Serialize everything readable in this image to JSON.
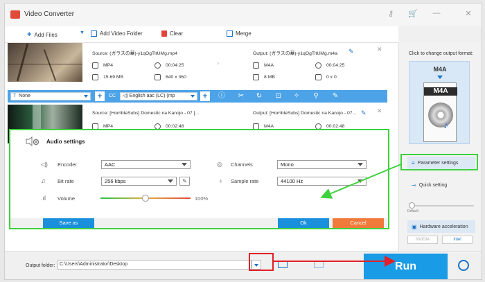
{
  "window": {
    "title": "Video Converter"
  },
  "toolbar": {
    "add_files": "Add Files",
    "add_video_folder": "Add Video Folder",
    "clear": "Clear",
    "merge": "Merge"
  },
  "files": [
    {
      "source_name": "Source: (ガラスの華)-y1qOgTltUMg.mp4",
      "source_format": "MP4",
      "source_duration": "00:04:25",
      "source_size": "15.69 MB",
      "source_resolution": "640 x 360",
      "output_name": "Output: (ガラスの華)-y1qOgTltUMg.m4a",
      "output_format": "M4A",
      "output_duration": "00:04:25",
      "output_size": "8 MB",
      "output_resolution": "0 x 0"
    },
    {
      "source_name": "Source: [HorribleSubs] Domestic na Kanojo - 07 [...",
      "source_format": "MP4",
      "source_duration": "00:02:48",
      "output_name": "Output: [HorribleSubs] Domestic na Kanojo - 07...",
      "output_format": "M4A",
      "output_duration": "00:02:48"
    }
  ],
  "edit_bar": {
    "subtitle": "None",
    "audio_track": "English aac (LC) (mp"
  },
  "right_panel": {
    "caption": "Click to change output format:",
    "format": "M4A",
    "format_art_label": "M4A",
    "parameter_settings": "Parameter settings",
    "quick_setting": "Quick setting",
    "default_label": "Default",
    "hw_accel": "Hardware acceleration",
    "nvidia": "NVIDIA",
    "intel": "Intel"
  },
  "bottom": {
    "output_folder_label": "Output folder:",
    "output_path": "C:\\Users\\Administrator\\Desktop",
    "run": "Run"
  },
  "audio_dialog": {
    "title": "Audio settings",
    "encoder_label": "Encoder",
    "encoder_value": "AAC",
    "bitrate_label": "Bit rate",
    "bitrate_value": "256 kbps",
    "channels_label": "Channels",
    "channels_value": "Mono",
    "samplerate_label": "Sample rate",
    "samplerate_value": "44100 Hz",
    "volume_label": "Volume",
    "volume_value": "100%",
    "volume_level": 0.5,
    "save_as": "Save as",
    "ok": "Ok",
    "cancel": "Cancel"
  },
  "colors": {
    "accent": "#1a9be6",
    "highlight_green": "#3dd23d",
    "annotation_red": "#e0202a",
    "ok_blue": "#1a8fdc",
    "cancel_orange": "#f07a3a"
  }
}
